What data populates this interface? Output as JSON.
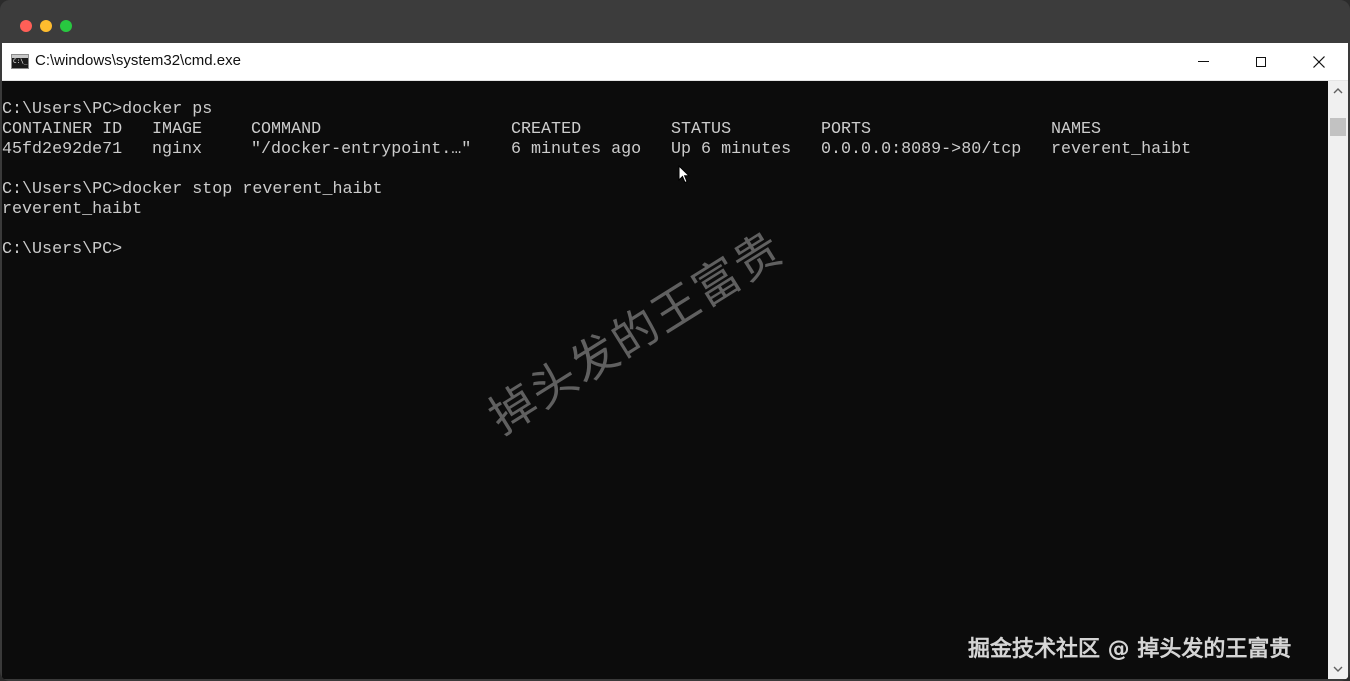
{
  "window": {
    "title": "C:\\windows\\system32\\cmd.exe"
  },
  "console": {
    "prompt1": "C:\\Users\\PC>docker ps",
    "headers": [
      "CONTAINER ID",
      "IMAGE",
      "COMMAND",
      "CREATED",
      "STATUS",
      "PORTS",
      "NAMES"
    ],
    "row": [
      "45fd2e92de71",
      "nginx",
      "\"/docker-entrypoint.…\"",
      "6 minutes ago",
      "Up 6 minutes",
      "0.0.0.0:8089->80/tcp",
      "reverent_haibt"
    ],
    "prompt2": "C:\\Users\\PC>docker stop reverent_haibt",
    "output2": "reverent_haibt",
    "prompt3": "C:\\Users\\PC>"
  },
  "watermark": {
    "diagonal": "掉头发的王富贵",
    "corner": "掘金技术社区 @ 掉头发的王富贵"
  },
  "icons": {
    "app": "cmd-icon",
    "minimize": "minimize-icon",
    "maximize": "maximize-icon",
    "close": "close-icon",
    "scroll_up": "chevron-up-icon",
    "scroll_down": "chevron-down-icon",
    "pointer": "mouse-pointer-icon"
  },
  "colors": {
    "console_bg": "#0c0c0c",
    "console_text": "#cccccc",
    "close_red": "#ff5f57",
    "minimize_yellow": "#febc2e",
    "maximize_green": "#28c840"
  }
}
